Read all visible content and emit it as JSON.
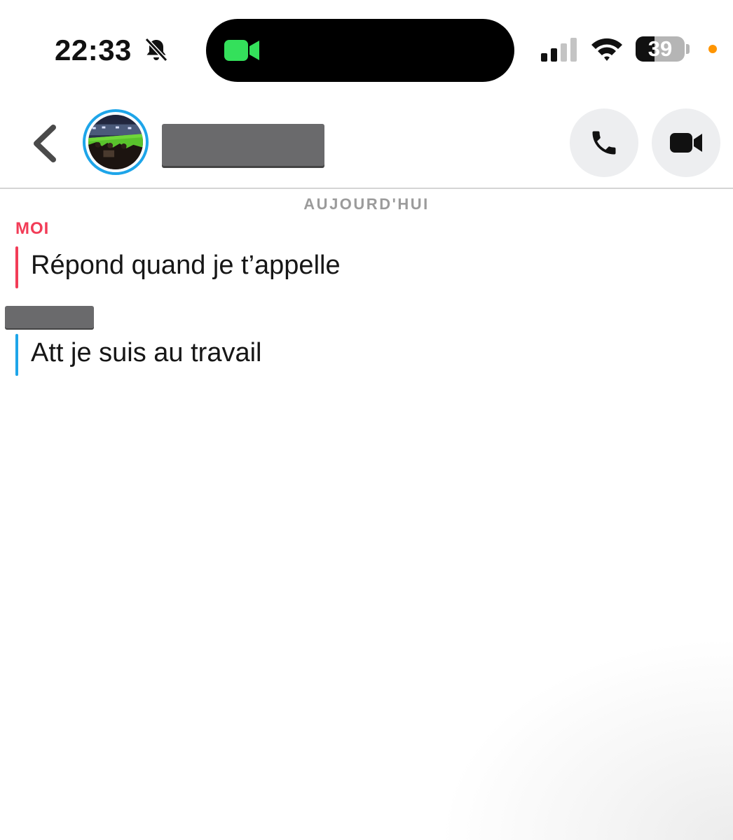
{
  "status_bar": {
    "time": "22:33",
    "battery_level": "39",
    "battery_fraction": 0.39,
    "icons": [
      "bell-slash-icon",
      "facetime-video-icon",
      "cellular-signal-icon",
      "wifi-icon",
      "battery-icon",
      "privacy-indicator-dot"
    ]
  },
  "header": {
    "icons": [
      "chevron-left-icon",
      "phone-icon",
      "video-camera-icon"
    ]
  },
  "chat": {
    "date_label": "AUJOURD'HUI",
    "messages": [
      {
        "sender": "MOI",
        "text": "Répond quand je t’appelle"
      },
      {
        "sender": "",
        "text": "Att je suis au travail"
      }
    ]
  },
  "colors": {
    "me_accent": "#f23c57",
    "friend_accent": "#1ea5e9",
    "facetime_green": "#34e05b",
    "privacy_dot": "#ff9500",
    "button_bg": "#edeef0"
  }
}
